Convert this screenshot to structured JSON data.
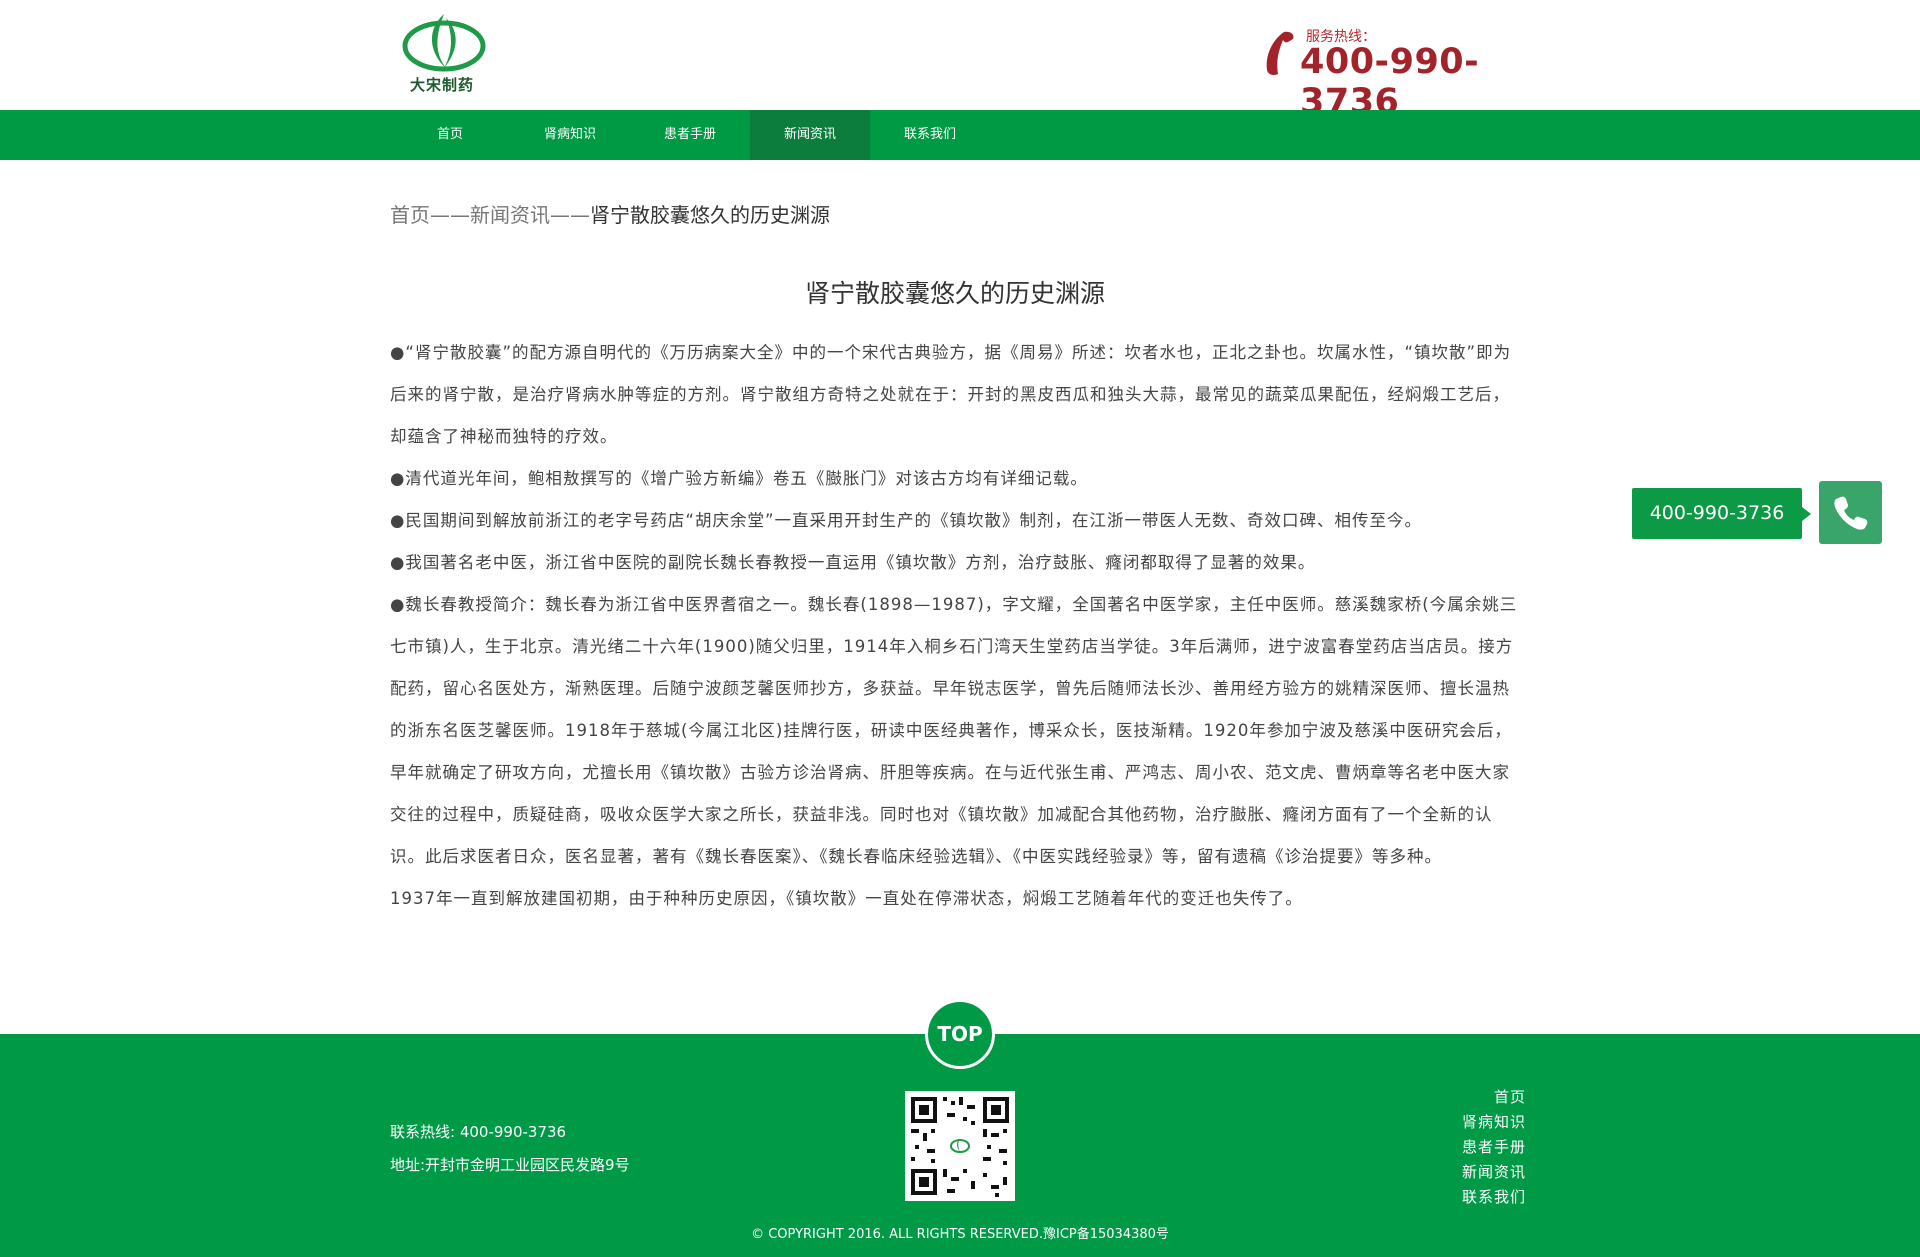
{
  "header": {
    "logo_text": "大宋制药",
    "hotline_label": "服务热线：",
    "hotline_number": "400-990-3736"
  },
  "nav": {
    "items": [
      {
        "label": "首页"
      },
      {
        "label": "肾病知识"
      },
      {
        "label": "患者手册"
      },
      {
        "label": "新闻资讯"
      },
      {
        "label": "联系我们"
      }
    ],
    "active_index": 3
  },
  "breadcrumb": {
    "home": "首页",
    "sep1": "——",
    "section": "新闻资讯",
    "sep2": "——",
    "current": "肾宁散胶囊悠久的历史渊源"
  },
  "article": {
    "title": "肾宁散胶囊悠久的历史渊源",
    "paragraphs": [
      "●“肾宁散胶囊”的配方源自明代的《万历病案大全》中的一个宋代古典验方，据《周易》所述：坎者水也，正北之卦也。坎属水性，“镇坎散”即为后来的肾宁散，是治疗肾病水肿等症的方剂。肾宁散组方奇特之处就在于：开封的黑皮西瓜和独头大蒜，最常见的蔬菜瓜果配伍，经焖煅工艺后，却蕴含了神秘而独特的疗效。",
      "●清代道光年间，鲍相敖撰写的《增广验方新编》卷五《臌胀门》对该古方均有详细记载。",
      "●民国期间到解放前浙江的老字号药店“胡庆余堂”一直采用开封生产的《镇坎散》制剂，在江浙一带医人无数、奇效口碑、相传至今。",
      "●我国著名老中医，浙江省中医院的副院长魏长春教授一直运用《镇坎散》方剂，治疗鼓胀、癃闭都取得了显著的效果。",
      "●魏长春教授简介：魏长春为浙江省中医界耆宿之一。魏长春(1898—1987)，字文耀，全国著名中医学家，主任中医师。慈溪魏家桥(今属余姚三七市镇)人，生于北京。清光绪二十六年(1900)随父归里，1914年入桐乡石门湾天生堂药店当学徒。3年后满师，进宁波富春堂药店当店员。接方配药，留心名医处方，渐熟医理。后随宁波颜芝馨医师抄方，多获益。早年锐志医学，曾先后随师法长沙、善用经方验方的姚精深医师、擅长温热的浙东名医芝馨医师。1918年于慈城(今属江北区)挂牌行医，研读中医经典著作，博采众长，医技渐精。1920年参加宁波及慈溪中医研究会后，早年就确定了研攻方向，尤擅长用《镇坎散》古验方诊治肾病、肝胆等疾病。在与近代张生甫、严鸿志、周小农、范文虎、曹炳章等名老中医大家交往的过程中，质疑硅商，吸收众医学大家之所长，获益非浅。同时也对《镇坎散》加减配合其他药物，治疗臌胀、癃闭方面有了一个全新的认识。此后求医者日众，医名显著，著有《魏长春医案》、《魏长春临床经验选辑》、《中医实践经验录》等，留有遗稿《诊治提要》等多种。",
      "1937年一直到解放建国初期，由于种种历史原因，《镇坎散》一直处在停滞状态，焖煅工艺随着年代的变迁也失传了。"
    ]
  },
  "float": {
    "phone_number": "400-990-3736"
  },
  "footer": {
    "top_label": "TOP",
    "contact_label": "联系热线:",
    "contact_number": "400-990-3736",
    "address": "地址:开封市金明工业园区民发路9号",
    "links": [
      "首页",
      "肾病知识",
      "患者手册",
      "新闻资讯",
      "联系我们"
    ],
    "copyright": "© COPYRIGHT 2016. ALL RIGHTS RESERVED.豫ICP备15034380号"
  },
  "colors": {
    "brand_green": "#009a44",
    "nav_active": "#0d7d3d",
    "hotline_red": "#a3232b"
  }
}
